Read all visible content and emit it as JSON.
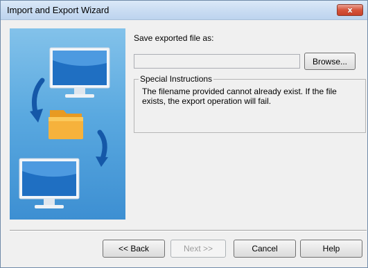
{
  "window": {
    "title": "Import and Export Wizard",
    "close_glyph": "x"
  },
  "content": {
    "save_label": "Save exported file as:",
    "file_value": "",
    "browse_label": "Browse..."
  },
  "instructions": {
    "legend": "Special Instructions",
    "text": "The filename provided cannot already exist. If the file exists, the export operation will fail."
  },
  "buttons": {
    "back": "<< Back",
    "next": "Next >>",
    "cancel": "Cancel",
    "help": "Help"
  },
  "illustration": {
    "icons": [
      "monitor-icon",
      "arrow-curve-icon",
      "folder-icon",
      "arrow-curve-icon",
      "monitor-icon"
    ],
    "colors": {
      "panel_top": "#83c2ea",
      "panel_bottom": "#3d8fd2",
      "folder": "#f6b23c",
      "screen": "#1f6fc2"
    }
  }
}
